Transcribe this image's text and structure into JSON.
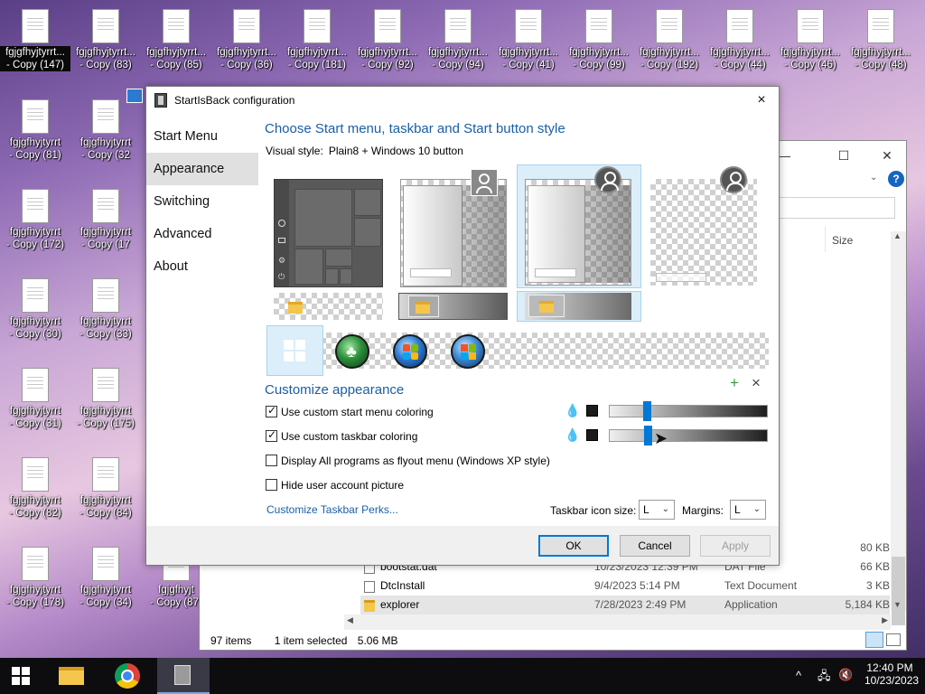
{
  "desktop": {
    "icons_row1": [
      {
        "name": "fgjgfhyjtyrrt...",
        "copy": "- Copy (147)"
      },
      {
        "name": "fgjgfhyjtyrrt...",
        "copy": "- Copy (83)"
      },
      {
        "name": "fgjgfhyjtyrrt...",
        "copy": "- Copy (85)"
      },
      {
        "name": "fgjgfhyjtyrrt...",
        "copy": "- Copy (36)"
      },
      {
        "name": "fgjgfhyjtyrrt...",
        "copy": "- Copy (181)"
      },
      {
        "name": "fgjgfhyjtyrrt...",
        "copy": "- Copy (92)"
      },
      {
        "name": "fgjgfhyjtyrrt...",
        "copy": "- Copy (94)"
      },
      {
        "name": "fgjgfhyjtyrrt...",
        "copy": "- Copy (41)"
      },
      {
        "name": "fgjgfhyjtyrrt...",
        "copy": "- Copy (99)"
      },
      {
        "name": "fgjgfhyjtyrrt...",
        "copy": "- Copy (192)"
      },
      {
        "name": "fgjgfhyjtyrrt...",
        "copy": "- Copy (44)"
      },
      {
        "name": "fgjgfhyjtyrrt...",
        "copy": "- Copy (46)"
      },
      {
        "name": "fgjgfhyjtyrrt...",
        "copy": "- Copy (48)"
      }
    ],
    "icons_col": [
      {
        "a": "- Copy (81)",
        "b": "- Copy (32"
      },
      {
        "a": "- Copy (172)",
        "b": "- Copy (17"
      },
      {
        "a": "- Copy (30)",
        "b": "- Copy (33)"
      },
      {
        "a": "- Copy (31)",
        "b": "- Copy (175)"
      },
      {
        "a": "- Copy (82)",
        "b": "- Copy (84)"
      },
      {
        "a": "- Copy (178)",
        "b": "- Copy (34)",
        "c": "- Copy (87)"
      }
    ],
    "icon_name": "fgjgfhyjtyrrt",
    "icon_name_short": "fgjgfhyjtyrrt...",
    "icon_name_cut": "fgjgfhyjt"
  },
  "explorer": {
    "column_size": "Size",
    "rows": [
      {
        "name": "",
        "date": "",
        "type": "",
        "size": "80 KB"
      },
      {
        "name": "bootstat.dat",
        "date": "10/23/2023 12:39 PM",
        "type": "DAT File",
        "size": "66 KB"
      },
      {
        "name": "DtcInstall",
        "date": "9/4/2023 5:14 PM",
        "type": "Text Document",
        "size": "3 KB"
      },
      {
        "name": "explorer",
        "date": "7/28/2023 2:49 PM",
        "type": "Application",
        "size": "5,184 KB"
      }
    ],
    "status": {
      "items": "97 items",
      "selected": "1 item selected",
      "size": "5.06 MB"
    },
    "help": "?"
  },
  "dialog": {
    "title": "StartIsBack configuration",
    "nav": [
      "Start Menu",
      "Appearance",
      "Switching",
      "Advanced",
      "About"
    ],
    "active_nav": "Appearance",
    "heading_style": "Choose Start menu, taskbar and Start button style",
    "visual_style_label": "Visual style:",
    "visual_style_value": "Plain8 + Windows 10 button",
    "heading_customize": "Customize appearance",
    "options": [
      {
        "label": "Use custom start menu coloring",
        "checked": true
      },
      {
        "label": "Use custom taskbar coloring",
        "checked": true
      },
      {
        "label": "Display All programs as flyout menu (Windows XP style)",
        "checked": false
      },
      {
        "label": "Hide user account picture",
        "checked": false
      }
    ],
    "slider_start_menu_level": 0.22,
    "slider_taskbar_level": 0.23,
    "add_icon": "+",
    "remove_icon": "×",
    "link": "Customize Taskbar Perks...",
    "icon_size_label": "Taskbar icon size:",
    "icon_size_value": "L",
    "margins_label": "Margins:",
    "margins_value": "L",
    "buttons": {
      "ok": "OK",
      "cancel": "Cancel",
      "apply": "Apply"
    },
    "close": "×"
  },
  "taskbar": {
    "time": "12:40 PM",
    "date": "10/23/2023"
  },
  "colors": {
    "accent": "#0078d7",
    "heading": "#1a5fa6",
    "selection": "#dbeefa"
  }
}
